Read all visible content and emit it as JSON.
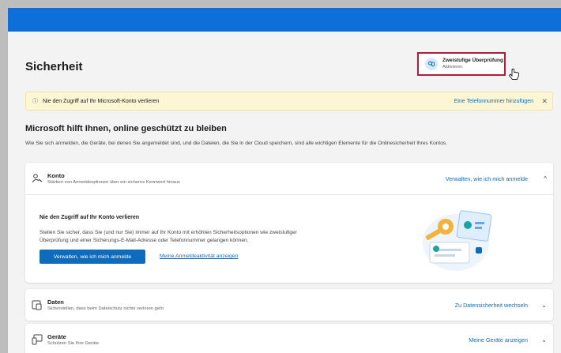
{
  "header": {
    "title": "Sicherheit",
    "two_factor": {
      "title": "Zweistufige Überprüfung",
      "subtitle": "Aktivieren"
    }
  },
  "banner": {
    "text": "Nie den Zugriff auf Ihr Microsoft-Konto verlieren",
    "link": "Eine Telefonnummer hinzufügen"
  },
  "section": {
    "title": "Microsoft hilft Ihnen, online geschützt zu bleiben",
    "description": "Wie Sie sich anmelden, die Geräte, bei denen Sie angemeldet sind, und die Dateien, die Sie in der Cloud speichern, sind alle wichtigen Elemente für die Onlinesicherheit Ihres Kontos."
  },
  "cards": {
    "konto": {
      "title": "Konto",
      "subtitle": "Stärken von Anmeldeoptionen über ein sicheres Kennwort hinaus",
      "link": "Verwalten, wie ich mich anmelde",
      "expanded": {
        "title": "Nie den Zugriff auf Ihr Konto verlieren",
        "text": "Stellen Sie sicher, dass Sie (und nur Sie) immer auf Ihr Konto mit erhöhten Sicherheitsoptionen wie zweistufiger Überprüfung und einer Sicherungs-E-Mail-Adresse oder Telefonnummer gelangen können.",
        "button": "Verwalten, wie ich mich anmelde",
        "link": "Meine Anmeldeaktivität anzeigen"
      }
    },
    "daten": {
      "title": "Daten",
      "subtitle": "Sicherstellen, dass beim Dateischutz nichts verloren geht",
      "link": "Zu Datensicherheit wechseln"
    },
    "geraete": {
      "title": "Geräte",
      "subtitle": "Schützen Sie Ihre Geräte",
      "link": "Meine Geräte anzeigen"
    }
  },
  "colors": {
    "topbar": "#0f6fd8",
    "accent": "#0f6cbd",
    "banner": "#fdf6d5",
    "highlight": "#b01e3b"
  }
}
